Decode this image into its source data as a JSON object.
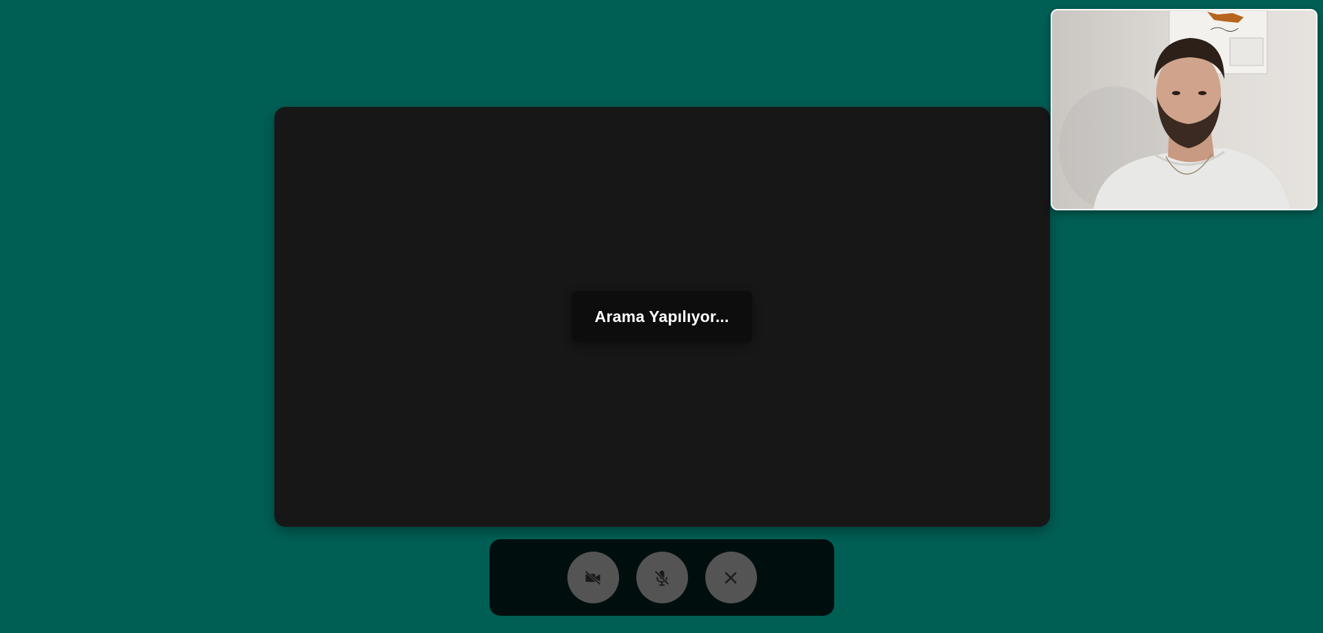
{
  "call": {
    "status_text": "Arama Yapılıyor..."
  },
  "controls": [
    {
      "icon": "video-off-icon",
      "label": "camera-toggle"
    },
    {
      "icon": "mic-off-icon",
      "label": "microphone-toggle"
    },
    {
      "icon": "close-icon",
      "label": "end-call"
    }
  ],
  "colors": {
    "background": "#005f55",
    "remote_panel": "#171717",
    "status_box": "#0d0d0d",
    "controls_bar": "#000f0d",
    "button": "#545454",
    "icon": "#1a1a1a"
  }
}
